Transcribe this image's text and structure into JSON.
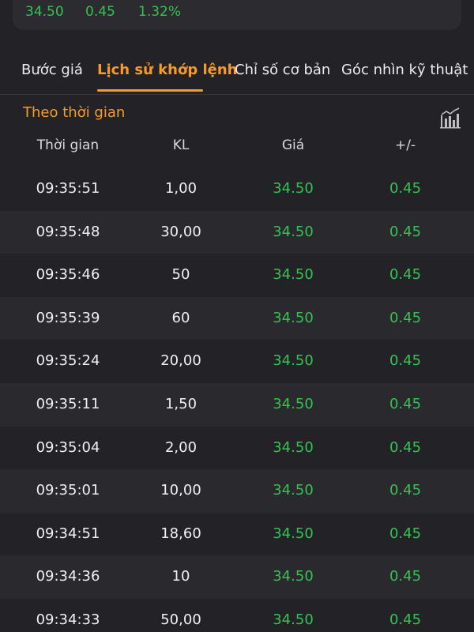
{
  "quote": {
    "price": "34.50",
    "change": "0.45",
    "percent": "1.32%"
  },
  "tabs": [
    {
      "label": "Bước giá"
    },
    {
      "label": "Lịch sử khớp lệnh"
    },
    {
      "label": "Chỉ số cơ bản"
    },
    {
      "label": "Góc nhìn kỹ thuật"
    }
  ],
  "section": {
    "title": "Theo thời gian",
    "chart_icon": "bar-chart-icon"
  },
  "table": {
    "headers": {
      "time": "Thời gian",
      "volume": "KL",
      "price": "Giá",
      "change": "+/-"
    },
    "rows": [
      {
        "time": "09:35:51",
        "volume": "1,00",
        "price": "34.50",
        "change": "0.45"
      },
      {
        "time": "09:35:48",
        "volume": "30,00",
        "price": "34.50",
        "change": "0.45"
      },
      {
        "time": "09:35:46",
        "volume": "50",
        "price": "34.50",
        "change": "0.45"
      },
      {
        "time": "09:35:39",
        "volume": "60",
        "price": "34.50",
        "change": "0.45"
      },
      {
        "time": "09:35:24",
        "volume": "20,00",
        "price": "34.50",
        "change": "0.45"
      },
      {
        "time": "09:35:11",
        "volume": "1,50",
        "price": "34.50",
        "change": "0.45"
      },
      {
        "time": "09:35:04",
        "volume": "2,00",
        "price": "34.50",
        "change": "0.45"
      },
      {
        "time": "09:35:01",
        "volume": "10,00",
        "price": "34.50",
        "change": "0.45"
      },
      {
        "time": "09:34:51",
        "volume": "18,60",
        "price": "34.50",
        "change": "0.45"
      },
      {
        "time": "09:34:36",
        "volume": "10",
        "price": "34.50",
        "change": "0.45"
      },
      {
        "time": "09:34:33",
        "volume": "50,00",
        "price": "34.50",
        "change": "0.45"
      }
    ]
  },
  "colors": {
    "accent": "#f79a2c",
    "up": "#36c153",
    "background": "#232327"
  }
}
